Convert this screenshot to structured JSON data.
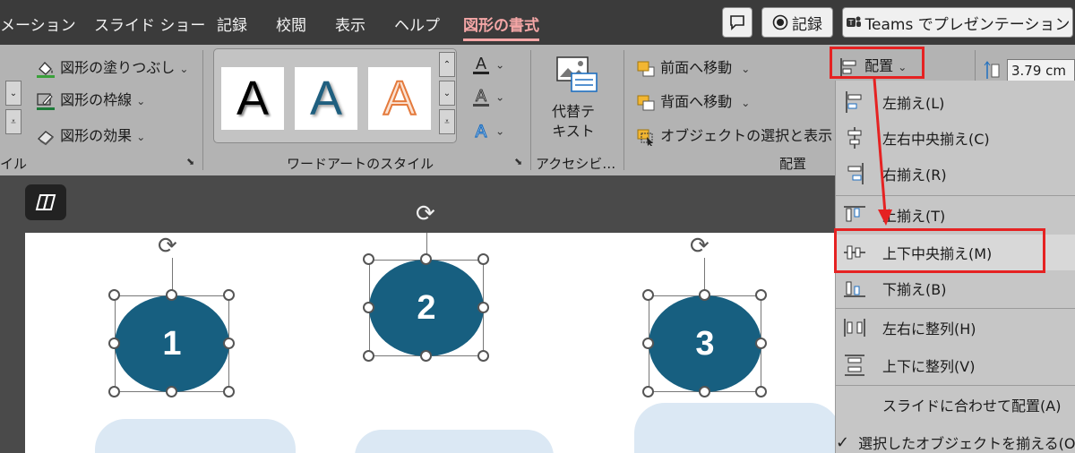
{
  "tabs": [
    "メーション",
    "スライド ショー",
    "記録",
    "校閲",
    "表示",
    "ヘルプ",
    "図形の書式"
  ],
  "top_buttons": {
    "record": "記録",
    "teams": "Teams でプレゼンテーション"
  },
  "shape_styles": {
    "fill": "図形の塗りつぶし",
    "outline": "図形の枠線",
    "effects": "図形の効果",
    "group_label_partial": "イル"
  },
  "wordart": {
    "letter": "A",
    "group_label": "ワードアートのスタイル"
  },
  "accessibility": {
    "alt_text": "代替テ\nキスト",
    "alt_text_line1": "代替テ",
    "alt_text_line2": "キスト",
    "group_label": "アクセシビ…"
  },
  "arrange": {
    "bring_forward": "前面へ移動",
    "send_backward": "背面へ移動",
    "selection_pane": "オブジェクトの選択と表示",
    "group_label": "配置",
    "align_button": "配置"
  },
  "size": {
    "height": "3.79 cm"
  },
  "slide": {
    "shapes": [
      "1",
      "2",
      "3"
    ]
  },
  "align_menu": [
    "左揃え(L)",
    "左右中央揃え(C)",
    "右揃え(R)",
    "上揃え(T)",
    "上下中央揃え(M)",
    "下揃え(B)",
    "左右に整列(H)",
    "上下に整列(V)",
    "スライドに合わせて配置(A)",
    "選択したオブジェクトを揃える(O)"
  ],
  "colors": {
    "shape_fill": "#175f80",
    "highlight": "#e52222",
    "active_tab": "#f4a6a6"
  }
}
